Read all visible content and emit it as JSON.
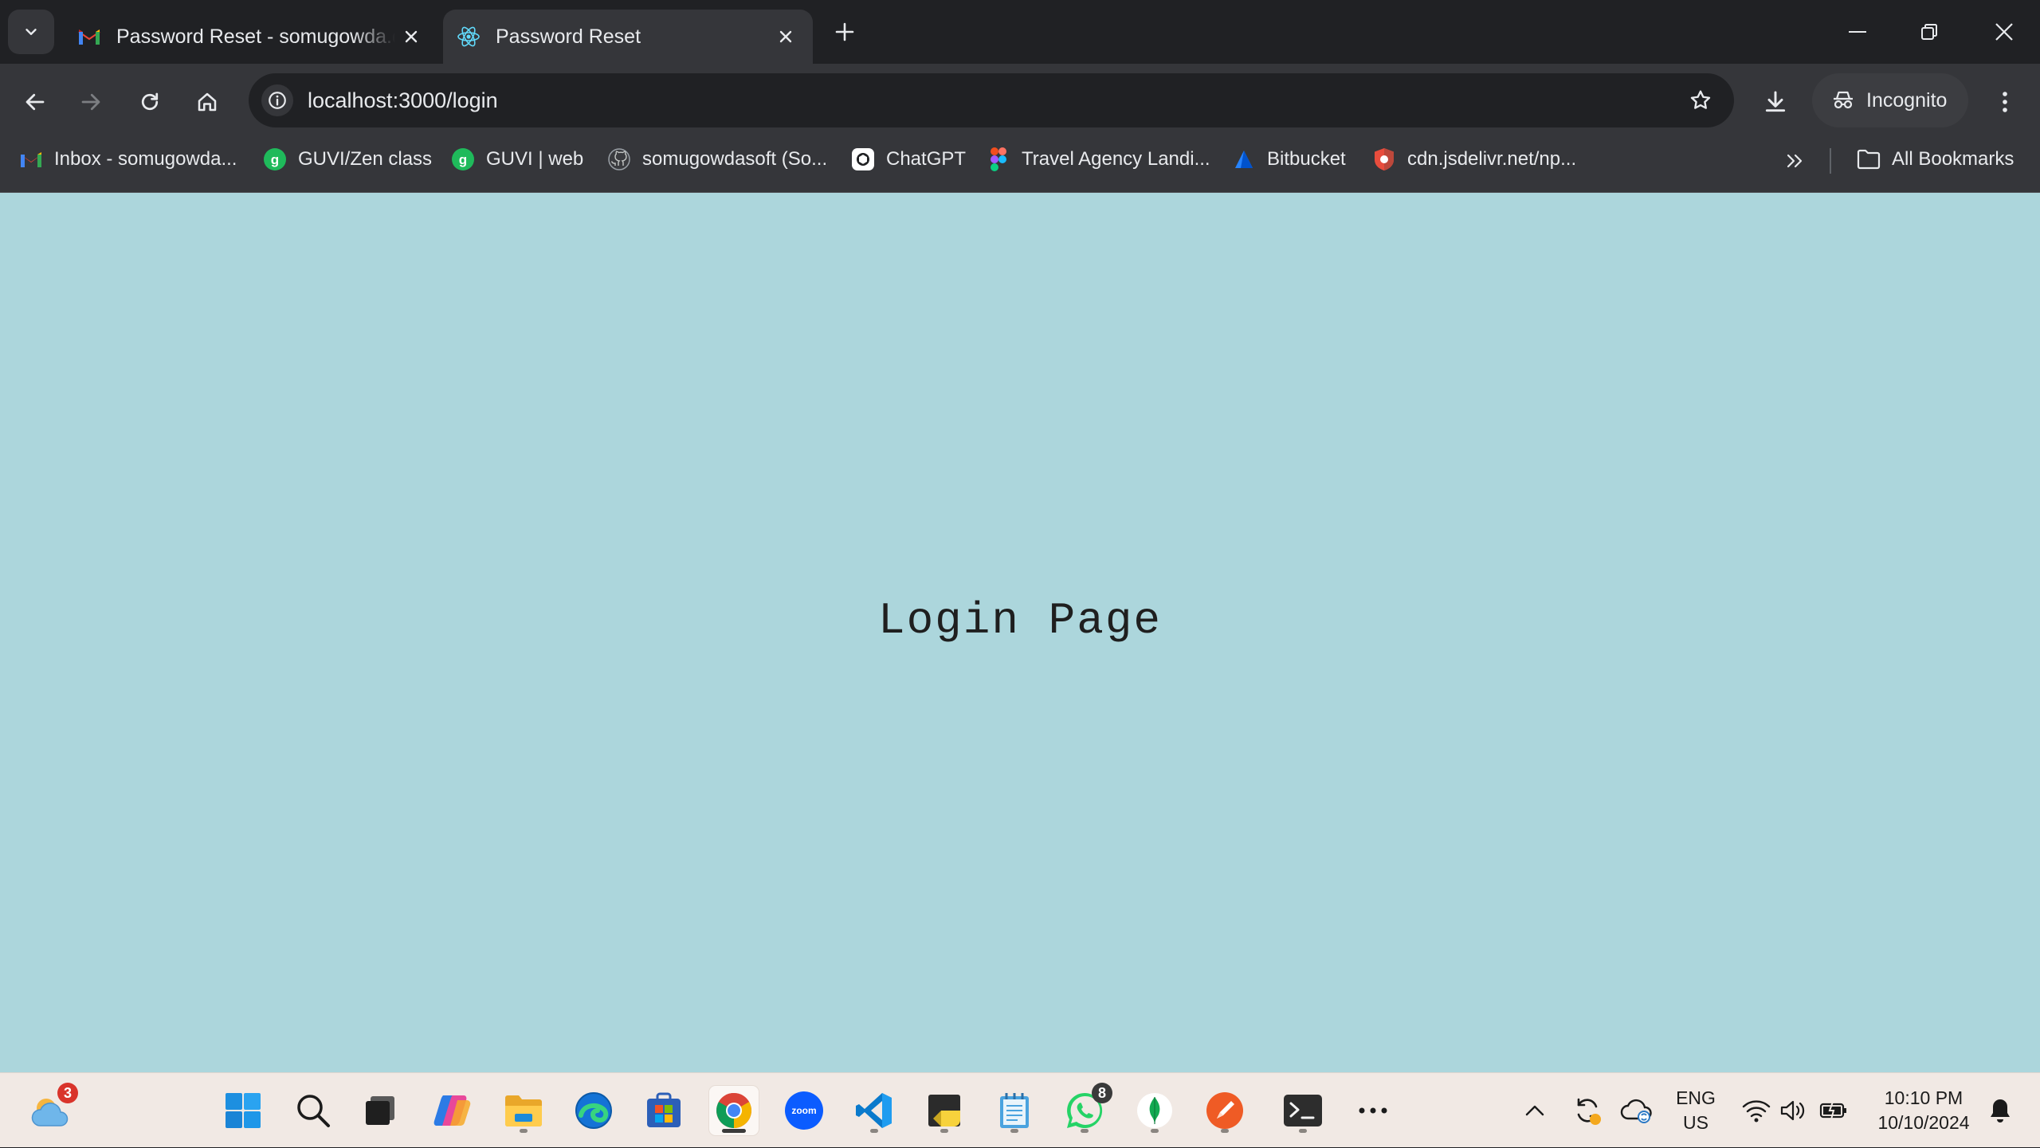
{
  "browser": {
    "tabs": [
      {
        "title": "Password Reset - somugowda.dev@gmail.com",
        "favicon": "gmail-icon",
        "active": false
      },
      {
        "title": "Password Reset",
        "favicon": "react-icon",
        "active": true
      }
    ],
    "url": "localhost:3000/login",
    "profile_label": "Incognito",
    "bookmarks": [
      {
        "label": "Inbox - somugowda...",
        "icon": "gmail-icon"
      },
      {
        "label": "GUVI/Zen class",
        "icon": "guvi-icon"
      },
      {
        "label": "GUVI | web",
        "icon": "guvi-icon"
      },
      {
        "label": "somugowdasoft (So...",
        "icon": "github-icon"
      },
      {
        "label": "ChatGPT",
        "icon": "chatgpt-icon"
      },
      {
        "label": "Travel Agency Landi...",
        "icon": "figma-icon"
      },
      {
        "label": "Bitbucket",
        "icon": "bitbucket-icon"
      },
      {
        "label": "cdn.jsdelivr.net/np...",
        "icon": "jsdelivr-icon"
      }
    ],
    "all_bookmarks_label": "All Bookmarks"
  },
  "page": {
    "heading": "Login Page",
    "background": "#acd6dc"
  },
  "taskbar": {
    "weather_badge": "3",
    "whatsapp_badge": "8",
    "language": "ENG",
    "region": "US",
    "time": "10:10 PM",
    "date": "10/10/2024",
    "apps": [
      "start",
      "search",
      "task-view",
      "copilot",
      "file-explorer",
      "edge",
      "microsoft-store",
      "chrome",
      "zoom",
      "vscode",
      "sticky-notes",
      "notepad",
      "whatsapp",
      "mongodb-compass",
      "postman",
      "terminal",
      "more"
    ]
  },
  "colors": {
    "chrome_dark": "#202124",
    "chrome_toolbar": "#35363a",
    "taskbar": "#f1e9e4"
  }
}
